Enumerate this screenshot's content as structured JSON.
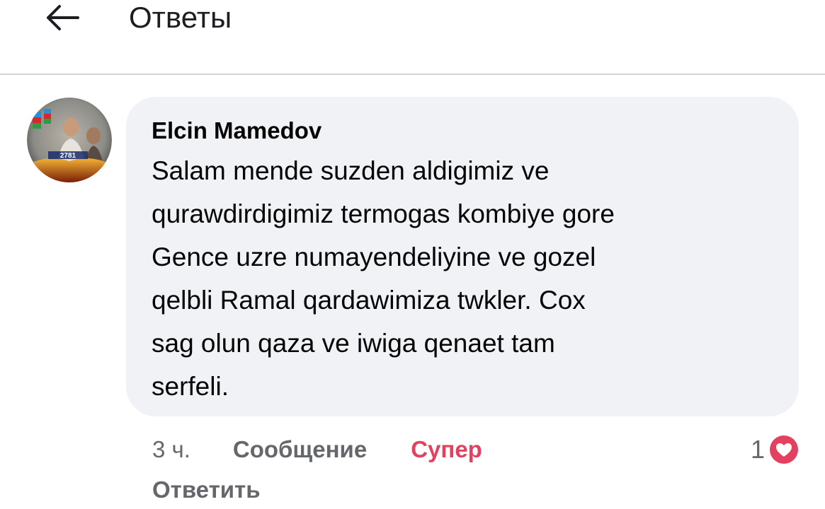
{
  "header": {
    "title": "Ответы",
    "back_icon": "arrow-left-icon"
  },
  "comment": {
    "author": "Elcin Mamedov",
    "text": "Salam mende suzden aldigimiz ve\nqurawdirdigimiz termogas kombiye gore\nGence uzre numayendeliyine ve gozel\nqelbli Ramal qardawimiza twkler. Cox\nsag olun qaza ve iwiga qenaet tam\nserfeli.",
    "avatar_badge_text": "2781",
    "time": "3 ч.",
    "message_label": "Сообщение",
    "reaction_label": "Супер",
    "reply_label": "Ответить",
    "reaction_count": "1",
    "reaction_icon": "heart-reaction-icon"
  },
  "colors": {
    "bubble": "#f0f2f5",
    "secondary_text": "#65676b",
    "super_reaction": "#e4405f",
    "divider": "#d4d4d4"
  }
}
